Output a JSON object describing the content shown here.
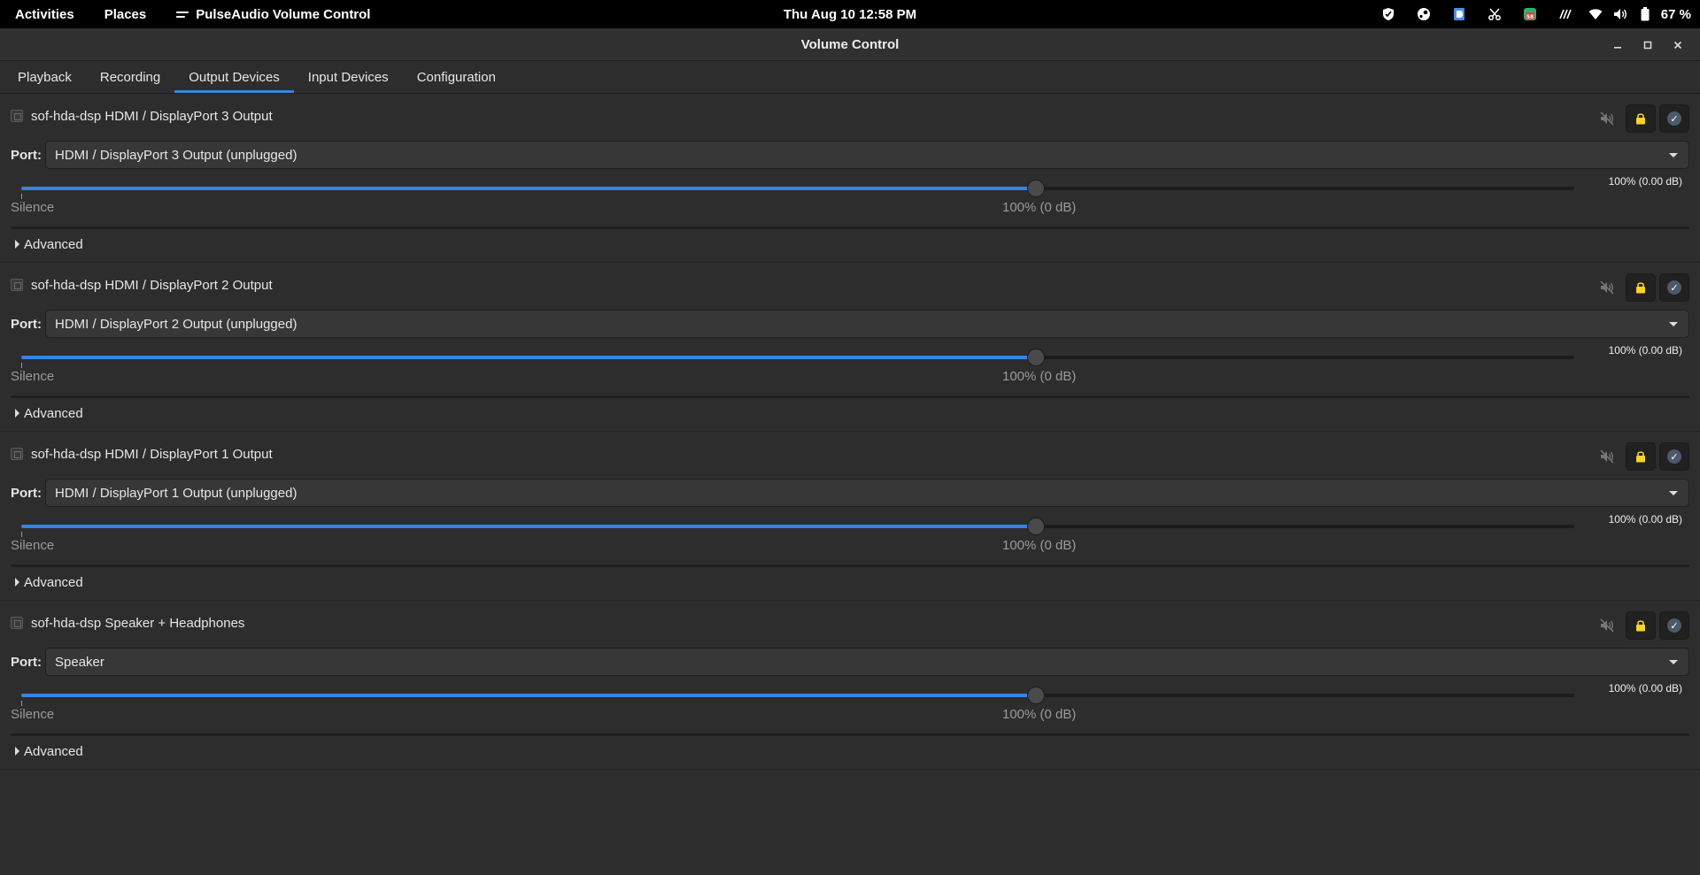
{
  "topbar": {
    "activities": "Activities",
    "places": "Places",
    "app_name": "PulseAudio Volume Control",
    "clock": "Thu Aug 10  12:58 PM",
    "tray_icons": [
      "shield-icon",
      "steam-icon",
      "dock-icon",
      "scissors-icon",
      "badge-icon",
      "wave-icon",
      "wifi-icon",
      "volume-icon",
      "battery-icon"
    ],
    "badge_count": "58",
    "battery": "67 %"
  },
  "window": {
    "title": "Volume Control"
  },
  "tabs": [
    {
      "label": "Playback"
    },
    {
      "label": "Recording"
    },
    {
      "label": "Output Devices"
    },
    {
      "label": "Input Devices"
    },
    {
      "label": "Configuration"
    }
  ],
  "active_tab": "Output Devices",
  "devices": [
    {
      "name": "sof-hda-dsp HDMI / DisplayPort 3 Output",
      "port_label": "Port:",
      "port": "HDMI / DisplayPort 3 Output (unplugged)",
      "volume_level": 100,
      "volume_readout": "100% (0.00 dB)",
      "silence_label": "Silence",
      "mark_label": "100% (0 dB)",
      "advanced_label": "Advanced"
    },
    {
      "name": "sof-hda-dsp HDMI / DisplayPort 2 Output",
      "port_label": "Port:",
      "port": "HDMI / DisplayPort 2 Output (unplugged)",
      "volume_level": 100,
      "volume_readout": "100% (0.00 dB)",
      "silence_label": "Silence",
      "mark_label": "100% (0 dB)",
      "advanced_label": "Advanced"
    },
    {
      "name": "sof-hda-dsp HDMI / DisplayPort 1 Output",
      "port_label": "Port:",
      "port": "HDMI / DisplayPort 1 Output (unplugged)",
      "volume_level": 100,
      "volume_readout": "100% (0.00 dB)",
      "silence_label": "Silence",
      "mark_label": "100% (0 dB)",
      "advanced_label": "Advanced"
    },
    {
      "name": "sof-hda-dsp Speaker + Headphones",
      "port_label": "Port:",
      "port": "Speaker",
      "volume_level": 100,
      "volume_readout": "100% (0.00 dB)",
      "silence_label": "Silence",
      "mark_label": "100% (0 dB)",
      "advanced_label": "Advanced"
    }
  ],
  "volume_max": 153,
  "colors": {
    "accent": "#3584e4",
    "lock": "#f6d32d"
  }
}
